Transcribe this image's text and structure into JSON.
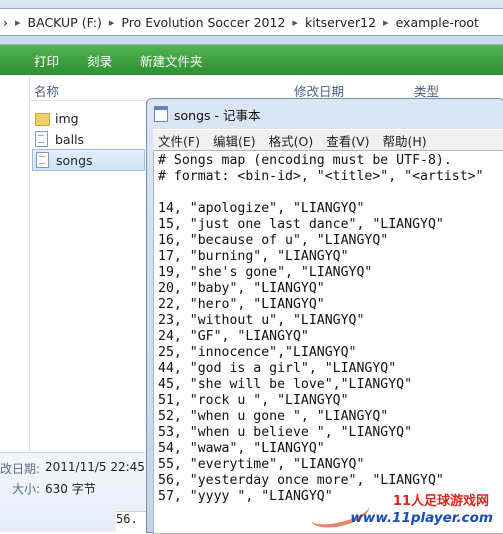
{
  "address_bar": {
    "crumbs": [
      "BACKUP (F:)",
      "Pro Evolution Soccer 2012",
      "kitserver12",
      "example-root"
    ],
    "separator": "▸",
    "nav_glyph": "›"
  },
  "toolbar": {
    "buttons": [
      "打印",
      "刻录",
      "新建文件夹"
    ]
  },
  "file_list": {
    "columns": [
      "名称",
      "修改日期",
      "类型"
    ],
    "items": [
      {
        "name": "img",
        "icon": "folder-icon"
      },
      {
        "name": "balls",
        "icon": "document-icon"
      },
      {
        "name": "songs",
        "icon": "document-icon",
        "selected": true
      }
    ]
  },
  "details_pane": {
    "modified_label": "改日期:",
    "modified_value": "2011/11/5 22:45",
    "size_label": "大小:",
    "size_value": "630 字节"
  },
  "notepad": {
    "title": "songs - 记事本",
    "menu": [
      "文件(F)",
      "编辑(E)",
      "格式(O)",
      "查看(V)",
      "帮助(H)"
    ],
    "lines": [
      "# Songs map (encoding must be UTF-8).",
      "# format: <bin-id>, \"<title>\", \"<artist>\"",
      "",
      "14, \"apologize\", \"LIANGYQ\"",
      "15, \"just one last dance\", \"LIANGYQ\"",
      "16, \"because of u\", \"LIANGYQ\"",
      "17, \"burning\", \"LIANGYQ\"",
      "19, \"she's gone\", \"LIANGYQ\"",
      "20, \"baby\", \"LIANGYQ\"",
      "22, \"hero\", \"LIANGYQ\"",
      "23, \"without u\", \"LIANGYQ\"",
      "24, \"GF\", \"LIANGYQ\"",
      "25, \"innocence\",\"LIANGYQ\"",
      "44, \"god is a girl\", \"LIANGYQ\"",
      "45, \"she will be love\",\"LIANGYQ\"",
      "51, \"rock u \", \"LIANGYQ\"",
      "52, \"when u gone \", \"LIANGYQ\"",
      "53, \"when u believe \", \"LIANGYQ\"",
      "54, \"wawa\", \"LIANGYQ\"",
      "55, \"everytime\", \"LIANGYQ\"",
      "56, \"yesterday once more\", \"LIANGYQ\"",
      "57, \"yyyy \", \"LIANGYQ\""
    ]
  },
  "behind_peek": "56.",
  "watermark": {
    "title": "11人足球游戏网",
    "url": "www.11player.com"
  },
  "colors": {
    "toolbar_green": "#3c9e3f",
    "watermark_red": "#d9261c",
    "watermark_blue": "#1a4db3"
  }
}
